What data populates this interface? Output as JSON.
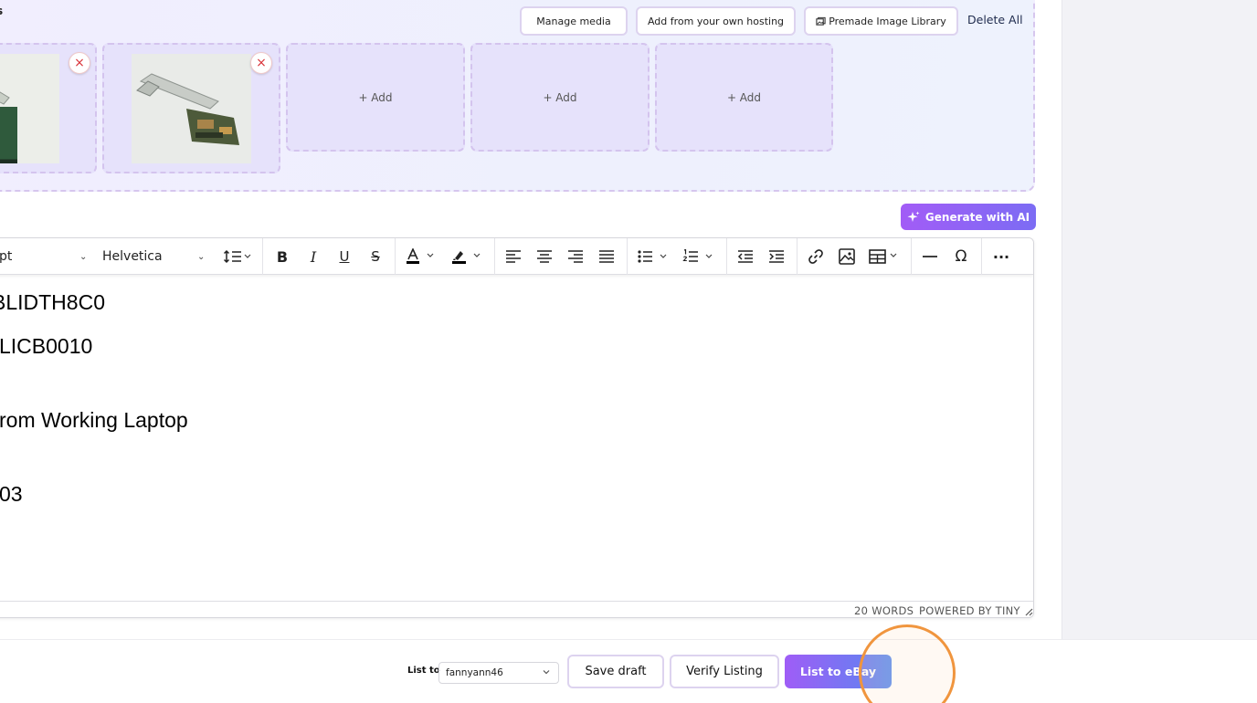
{
  "media": {
    "section_label": "s",
    "manage_media": "Manage media",
    "add_hosting": "Add from your own hosting",
    "premade_library": "Premade Image Library",
    "delete_all": "Delete All",
    "remove_icon": "×",
    "add_label": "+ Add"
  },
  "ai": {
    "generate_label": "Generate with AI"
  },
  "editor": {
    "font_size": "pt",
    "font_family": "Helvetica",
    "lines": [
      "BLIDTH8C0",
      "LICB0010",
      "rom Working Laptop",
      "03"
    ],
    "word_count": "20 WORDS",
    "powered_by": "POWERED BY TINY"
  },
  "bottom_bar": {
    "list_to_label": "List to",
    "account": "fannyann46",
    "save_draft": "Save draft",
    "verify_listing": "Verify Listing",
    "list_to_ebay": "List to eBay"
  },
  "colors": {
    "accent_start": "#a25cf6",
    "accent_end": "#5b8ef0",
    "remove_red": "#d9343a",
    "cursor_ring": "#f0953e"
  }
}
